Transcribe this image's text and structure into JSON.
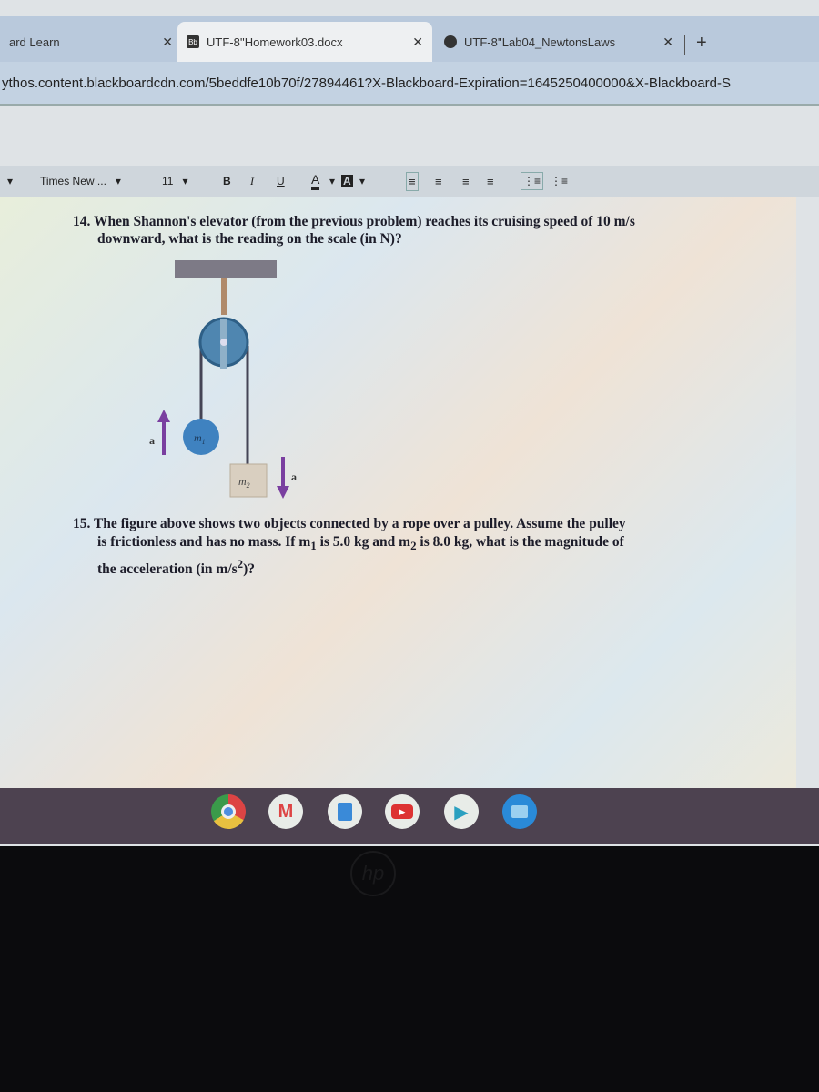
{
  "browser": {
    "tabs": [
      {
        "label": "ard Learn",
        "active": false
      },
      {
        "label": "UTF-8''Homework03.docx",
        "active": true,
        "icon": "blackboard-icon",
        "icon_text": "Bb"
      },
      {
        "label": "UTF-8''Lab04_NewtonsLaws",
        "active": false,
        "icon": "globe-icon"
      }
    ],
    "close_glyph": "✕",
    "new_tab_glyph": "+",
    "url": "ythos.content.blackboardcdn.com/5beddfe10b70f/27894461?X-Blackboard-Expiration=1645250400000&X-Blackboard-S"
  },
  "toolbar": {
    "font_name": "Times New ...",
    "font_size": "11",
    "bold": "B",
    "italic": "I",
    "underline": "U",
    "text_color": "A",
    "highlight": "A",
    "dropdown_glyph": "▾"
  },
  "document": {
    "q14": {
      "line1": "14. When Shannon's elevator (from the previous problem) reaches its cruising speed of 10 m/s",
      "line2": "downward, what is the reading on the scale (in N)?"
    },
    "figure": {
      "m1": "m",
      "m1_sub": "1",
      "m2": "m",
      "m2_sub": "2",
      "accel": "a"
    },
    "q15": {
      "line1": "15. The figure above shows two objects connected by a rope over a pulley. Assume the pulley",
      "line2_a": "is frictionless and has no mass. If m",
      "sub1": "1",
      "line2_b": " is 5.0 kg and m",
      "sub2": "2",
      "line2_c": " is 8.0 kg, what is the magnitude of",
      "line3_a": "the acceleration (in m/s",
      "sup": "2",
      "line3_b": ")?"
    }
  },
  "shelf": {
    "apps": [
      "chrome",
      "gmail",
      "docs",
      "youtube",
      "play-store",
      "files"
    ]
  },
  "bezel": {
    "logo": "hp"
  }
}
